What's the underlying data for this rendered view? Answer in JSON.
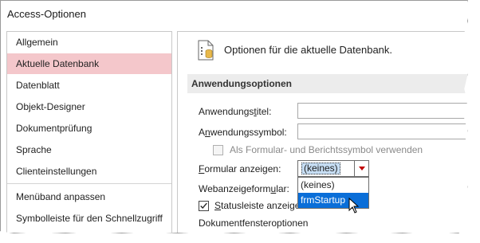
{
  "window": {
    "title": "Access-Optionen"
  },
  "sidebar": {
    "items": [
      {
        "label": "Allgemein"
      },
      {
        "label": "Aktuelle Datenbank"
      },
      {
        "label": "Datenblatt"
      },
      {
        "label": "Objekt-Designer"
      },
      {
        "label": "Dokumentprüfung"
      },
      {
        "label": "Sprache"
      },
      {
        "label": "Clienteinstellungen"
      },
      {
        "label": "Menüband anpassen"
      },
      {
        "label": "Symbolleiste für den Schnellzugriff"
      }
    ],
    "active_index": 1
  },
  "main": {
    "header_icon": "database-options-icon",
    "header_text": "Optionen für die aktuelle Datenbank.",
    "section_title": "Anwendungsoptionen",
    "app_title": {
      "label_pre": "Anwendungs",
      "label_ul": "t",
      "label_post": "itel:",
      "value": ""
    },
    "app_icon": {
      "label_pre": "A",
      "label_ul": "n",
      "label_post": "wendungssymbol:",
      "value": ""
    },
    "use_as_form_icon": {
      "label": "Als Formular- und Berichtssymbol verwenden",
      "checked": false,
      "enabled": false
    },
    "display_form": {
      "label_pre": "",
      "label_ul": "F",
      "label_post": "ormular anzeigen:",
      "selected": "(keines)",
      "options": [
        "(keines)",
        "frmStartup"
      ],
      "highlighted": "frmStartup"
    },
    "web_display_form": {
      "label_pre": "Webanzeigeform",
      "label_ul": "u",
      "label_post": "lar:"
    },
    "status_bar": {
      "label_pre": "",
      "label_ul": "S",
      "label_post": "tatusleiste anzeigen",
      "checked": true
    },
    "document_window_options": {
      "label": "Dokumentfensteroptionen"
    }
  },
  "colors": {
    "active_nav_bg": "#f4c7cb",
    "section_bg": "#ececec",
    "dropdown_highlight": "#0a6ed8",
    "combo_selection": "#c6ddf3"
  }
}
